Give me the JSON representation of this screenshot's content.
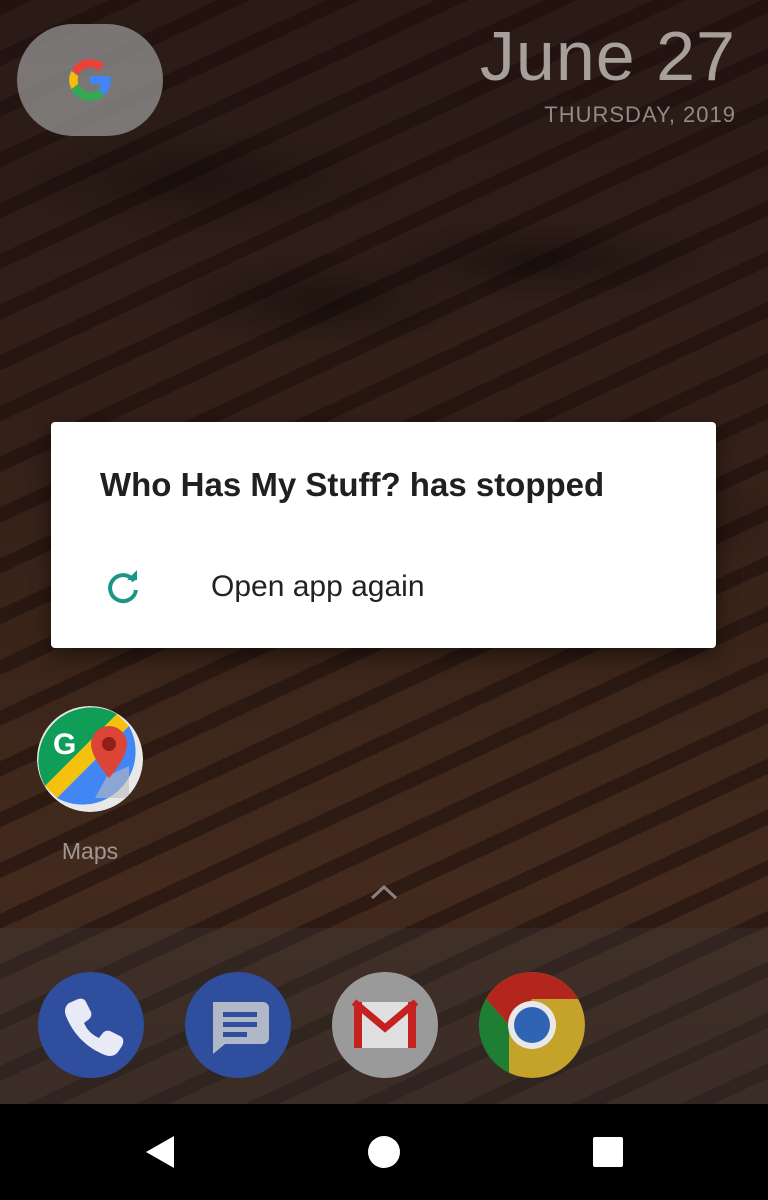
{
  "status": {
    "date_big": "June 27",
    "date_small": "THURSDAY, 2019"
  },
  "dialog": {
    "title": "Who Has My Stuff? has stopped",
    "action_label": "Open app again",
    "action_icon": "refresh-icon",
    "accent_color": "#1a9688"
  },
  "home": {
    "apps": [
      {
        "label": "Maps",
        "icon": "google-maps-icon"
      }
    ],
    "dock": [
      {
        "icon": "phone-icon"
      },
      {
        "icon": "messages-icon"
      },
      {
        "icon": "gmail-icon"
      },
      {
        "icon": "chrome-icon"
      }
    ]
  },
  "navbar": {
    "back_icon": "back-triangle-icon",
    "home_icon": "home-circle-icon",
    "recents_icon": "recents-square-icon"
  }
}
